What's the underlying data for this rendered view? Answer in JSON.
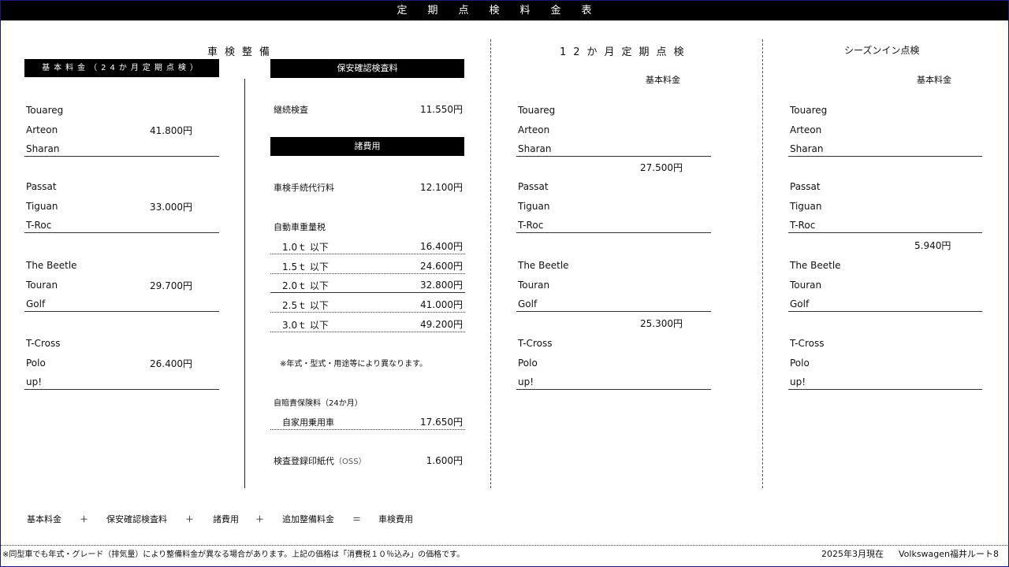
{
  "title": "定期点検料金表",
  "shaken": {
    "heading": "車検整備",
    "base_label": "基本料金（24か月定期点検）",
    "groups": [
      {
        "models": [
          "Touareg",
          "Arteon",
          "Sharan"
        ],
        "price": "41.800円"
      },
      {
        "models": [
          "Passat",
          "Tiguan",
          "T-Roc"
        ],
        "price": "33.000円"
      },
      {
        "models": [
          "The Beetle",
          "Touran",
          "Golf"
        ],
        "price": "29.700円"
      },
      {
        "models": [
          "T-Cross",
          "Polo",
          "up!"
        ],
        "price": "26.400円"
      }
    ],
    "safety_label": "保安確認検査料",
    "safety_item": "継続検査",
    "safety_price": "11.550円",
    "misc_label": "諸費用",
    "proxy_item": "車検手続代行料",
    "proxy_price": "12.100円",
    "weight_tax_label": "自動車重量税",
    "weight_tax": [
      {
        "label": "1.0ｔ 以下",
        "price": "16.400円"
      },
      {
        "label": "1.5ｔ 以下",
        "price": "24.600円"
      },
      {
        "label": "2.0ｔ 以下",
        "price": "32.800円"
      },
      {
        "label": "2.5ｔ 以下",
        "price": "41.000円"
      },
      {
        "label": "3.0ｔ 以下",
        "price": "49.200円"
      }
    ],
    "note": "※年式・型式・用途等により異なります。",
    "insurance_label": "自賠責保険料（24か月）",
    "insurance_item": "自家用乗用車",
    "insurance_price": "17.650円",
    "stamp_item": "検査登録印紙代",
    "stamp_sub": "（OSS）",
    "stamp_price": "1.600円"
  },
  "twelve": {
    "heading": "12か月定期点検",
    "base_label": "基本料金",
    "groups": [
      {
        "models": [
          "Touareg",
          "Arteon",
          "Sharan"
        ]
      },
      {
        "models": [
          "Passat",
          "Tiguan",
          "T-Roc"
        ]
      },
      {
        "models": [
          "The Beetle",
          "Touran",
          "Golf"
        ]
      },
      {
        "models": [
          "T-Cross",
          "Polo",
          "up!"
        ]
      }
    ],
    "price_a": "27.500円",
    "price_b": "25.300円"
  },
  "season": {
    "heading": "シーズンイン点検",
    "base_label": "基本料金",
    "groups": [
      {
        "models": [
          "Touareg",
          "Arteon",
          "Sharan"
        ]
      },
      {
        "models": [
          "Passat",
          "Tiguan",
          "T-Roc"
        ]
      },
      {
        "models": [
          "The Beetle",
          "Touran",
          "Golf"
        ]
      },
      {
        "models": [
          "T-Cross",
          "Polo",
          "up!"
        ]
      }
    ],
    "price": "5.940円"
  },
  "formula": [
    "基本料金",
    "＋",
    "保安確認検査料",
    "＋",
    "諸費用",
    "＋",
    "追加整備料金",
    "＝",
    "車検費用"
  ],
  "footer": {
    "disclaimer": "※同型車でも年式・グレード（排気量）により整備料金が異なる場合があります。上記の価格は「消費税１０％込み」の価格です。",
    "date": "2025年3月現在",
    "dealer": "Volkswagen福井ルート8"
  }
}
